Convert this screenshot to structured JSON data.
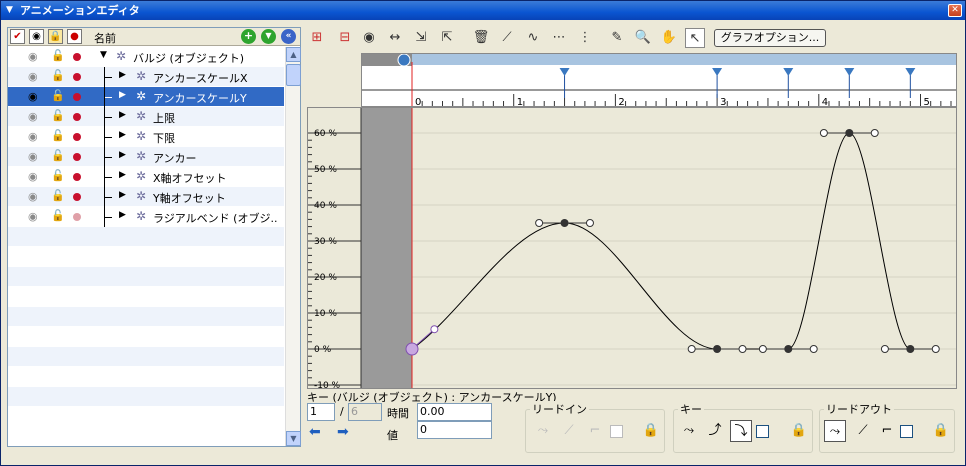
{
  "window": {
    "title": "アニメーションエディタ"
  },
  "columns": {
    "name": "名前"
  },
  "tree": [
    {
      "label": "バルジ (オブジェクト)",
      "level": 0,
      "selected": false
    },
    {
      "label": "アンカースケールX",
      "level": 1,
      "selected": false
    },
    {
      "label": "アンカースケールY",
      "level": 1,
      "selected": true
    },
    {
      "label": "上限",
      "level": 1,
      "selected": false
    },
    {
      "label": "下限",
      "level": 1,
      "selected": false
    },
    {
      "label": "アンカー",
      "level": 1,
      "selected": false
    },
    {
      "label": "X軸オフセット",
      "level": 1,
      "selected": false
    },
    {
      "label": "Y軸オフセット",
      "level": 1,
      "selected": false
    },
    {
      "label": "ラジアルベンド (オブジ..",
      "level": 1,
      "selected": false
    }
  ],
  "toolbar": {
    "graph_options": "グラフオプション..."
  },
  "timeline": {
    "ticks": [
      "0",
      "1",
      "2",
      "3",
      "4",
      "5"
    ],
    "keyframes": [
      1.5,
      3.0,
      3.7,
      4.3,
      4.9
    ]
  },
  "graph": {
    "y_labels": [
      "60 %",
      "50 %",
      "40 %",
      "30 %",
      "20 %",
      "10 %",
      "0 %",
      "-10 %"
    ],
    "key_values": [
      [
        0,
        0
      ],
      [
        1.5,
        35
      ],
      [
        3.0,
        0
      ],
      [
        3.7,
        0
      ],
      [
        4.3,
        60
      ],
      [
        4.9,
        0
      ]
    ]
  },
  "key_panel": {
    "title": "キー (バルジ (オブジェクト) : アンカースケールY)",
    "index": "1",
    "separator": "/",
    "count": "6",
    "time_label": "時間",
    "time_value": "0.00",
    "value_label": "値",
    "value": "0",
    "lead_in": "リードイン",
    "key": "キー",
    "lead_out": "リードアウト"
  },
  "colors": {
    "accent": "#316AC5",
    "titlebar": "#0A55D1",
    "marker": "#3A78C0"
  }
}
